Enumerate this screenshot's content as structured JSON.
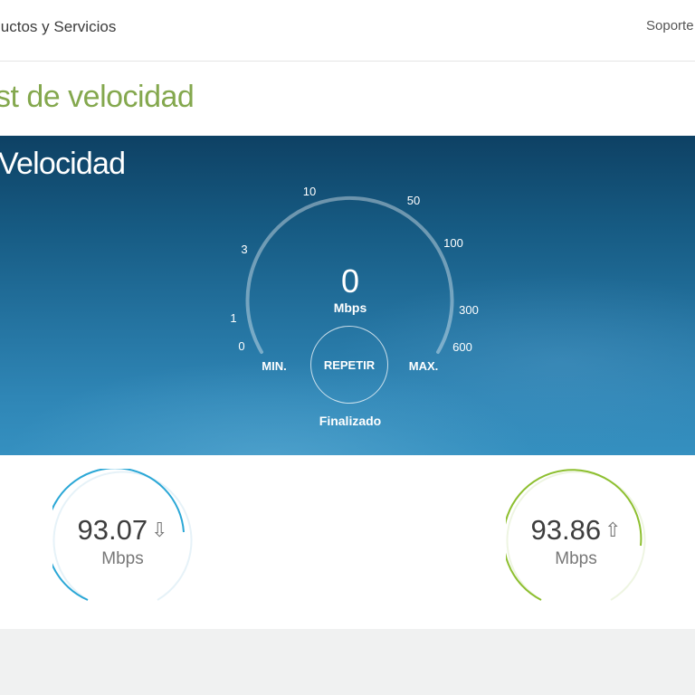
{
  "nav": {
    "products": "luctos y Servicios",
    "support": "Soporte"
  },
  "page": {
    "title": "st de velocidad"
  },
  "speedtest": {
    "title": "Velocidad",
    "scale_ticks": [
      "0",
      "1",
      "3",
      "10",
      "50",
      "100",
      "300",
      "600"
    ],
    "current_value": "0",
    "current_unit": "Mbps",
    "min_label": "MIN.",
    "max_label": "MAX.",
    "repeat_label": "REPETIR",
    "status": "Finalizado"
  },
  "results": {
    "download": {
      "value": "93.07",
      "unit": "Mbps",
      "icon": "download-arrow-icon",
      "arrow_glyph": "⇩",
      "color": "#2aa7d6"
    },
    "upload": {
      "value": "93.86",
      "unit": "Mbps",
      "icon": "upload-arrow-icon",
      "arrow_glyph": "⇧",
      "color": "#8dbf2f"
    }
  },
  "colors": {
    "title_green": "#84a84e",
    "banner_top": "#0e4164",
    "banner_bottom": "#3590c0",
    "footer_grey": "#f0f1f1"
  }
}
